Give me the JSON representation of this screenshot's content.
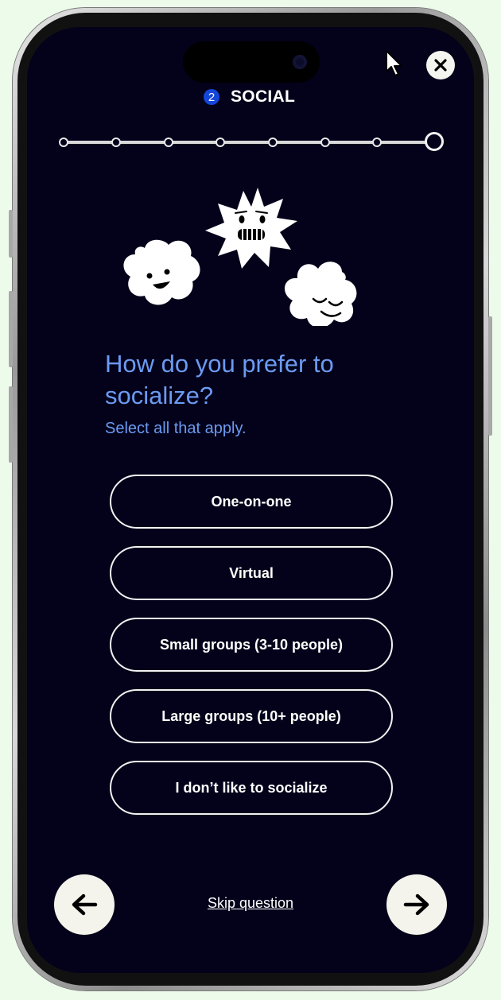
{
  "section": {
    "number": "2",
    "title": "SOCIAL"
  },
  "progress": {
    "steps": 8,
    "current": 8
  },
  "question": {
    "title": "How do you prefer to socialize?",
    "subtitle": "Select all that apply."
  },
  "options": [
    {
      "label": "One-on-one"
    },
    {
      "label": "Virtual"
    },
    {
      "label": "Small groups (3-10 people)"
    },
    {
      "label": "Large groups (10+ people)"
    },
    {
      "label": "I don’t like to socialize"
    }
  ],
  "footer": {
    "skip_label": "Skip question"
  },
  "icons": {
    "close": "close-icon",
    "back": "arrow-left-icon",
    "next": "arrow-right-icon",
    "cursor": "mouse-cursor-icon"
  },
  "colors": {
    "background": "#04021a",
    "accent_text": "#6b9bf2",
    "section_badge": "#1346d9",
    "button_fill": "#f5f4ec",
    "page_background": "#ecfbea"
  }
}
